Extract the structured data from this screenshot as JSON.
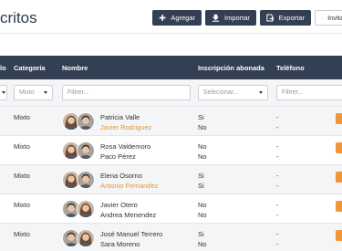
{
  "header": {
    "title": "critos"
  },
  "toolbar": {
    "agregar": "Agregar",
    "importar": "Importar",
    "exportar": "Exportar",
    "invitar": "Invita"
  },
  "table": {
    "headers": {
      "col0": "lo",
      "categoria": "Categoría",
      "nombre": "Nombre",
      "inscripcion": "Inscripción abonada",
      "telefono": "Teléfono"
    },
    "filters": {
      "categoria": "Mixto",
      "nombre_placeholder": "Filtrer...",
      "inscripcion": "Selecionar...",
      "telefono_placeholder": "Filtrer..."
    },
    "rows": [
      {
        "categoria": "Mixto",
        "p1": {
          "name": "Patricia Valle",
          "insc": "Si",
          "tel": "-",
          "orange": false,
          "gender": "f"
        },
        "p2": {
          "name": "Javier Rodriguez",
          "insc": "No",
          "tel": "-",
          "orange": true,
          "gender": "m"
        }
      },
      {
        "categoria": "Mixto",
        "p1": {
          "name": "Rosa Valdemoro",
          "insc": "No",
          "tel": "-",
          "orange": false,
          "gender": "f"
        },
        "p2": {
          "name": "Paco Pérez",
          "insc": "No",
          "tel": "-",
          "orange": false,
          "gender": "m"
        }
      },
      {
        "categoria": "Mixto",
        "p1": {
          "name": "Elena Osorno",
          "insc": "Si",
          "tel": "-",
          "orange": false,
          "gender": "f"
        },
        "p2": {
          "name": "Antonio Fernandez",
          "insc": "Si",
          "tel": "-",
          "orange": true,
          "gender": "m"
        }
      },
      {
        "categoria": "Mixto",
        "p1": {
          "name": "Javier Otero",
          "insc": "No",
          "tel": "-",
          "orange": false,
          "gender": "m"
        },
        "p2": {
          "name": "Andrea Menendez",
          "insc": "No",
          "tel": "-",
          "orange": false,
          "gender": "f"
        }
      },
      {
        "categoria": "Mixto",
        "p1": {
          "name": "José Manuel Terrero",
          "insc": "Si",
          "tel": "-",
          "orange": false,
          "gender": "m"
        },
        "p2": {
          "name": "Sara Moreno",
          "insc": "No",
          "tel": "-",
          "orange": false,
          "gender": "f"
        }
      }
    ]
  },
  "colors": {
    "header_bg": "#333f53",
    "accent_orange": "#e8962a",
    "row_alt": "#f4f5f7"
  },
  "icons": {
    "agregar": "plus-icon",
    "importar": "import-icon",
    "exportar": "export-icon",
    "invitar": "mail-icon",
    "filter": "chevron-down-icon"
  }
}
